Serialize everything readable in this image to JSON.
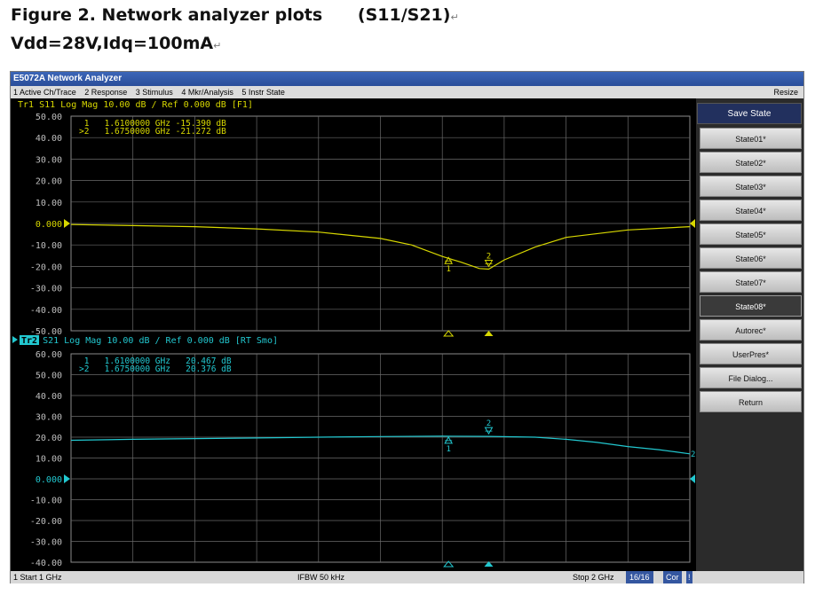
{
  "caption": {
    "line1": "Figure 2. Network analyzer plots      (S11/S21)",
    "line2": "Vdd=28V,Idq=100mA"
  },
  "window": {
    "title": "E5072A Network Analyzer"
  },
  "menu": {
    "items": [
      "1 Active Ch/Trace",
      "2 Response",
      "3 Stimulus",
      "4 Mkr/Analysis",
      "5 Instr State"
    ],
    "resize": "Resize"
  },
  "trace1": {
    "header_id": "Tr1",
    "header_rest": " S11  Log Mag 10.00 dB / Ref 0.000 dB [F1]",
    "y_ticks": [
      "50.00",
      "40.00",
      "30.00",
      "20.00",
      "10.00",
      "0.000",
      "-10.00",
      "-20.00",
      "-30.00",
      "-40.00",
      "-50.00"
    ],
    "markers": [
      {
        "line": " 1   1.6100000 GHz -15.390 dB"
      },
      {
        "line": ">2   1.6750000 GHz -21.272 dB"
      }
    ],
    "color": "#d8d800"
  },
  "trace2": {
    "header_id": "Tr2",
    "header_rest": " S21  Log Mag 10.00 dB / Ref 0.000 dB [RT Smo]",
    "y_ticks": [
      "60.00",
      "50.00",
      "40.00",
      "30.00",
      "20.00",
      "10.00",
      "0.000",
      "-10.00",
      "-20.00",
      "-30.00",
      "-40.00"
    ],
    "markers": [
      {
        "line": " 1   1.6100000 GHz   20.467 dB"
      },
      {
        "line": ">2   1.6750000 GHz   20.376 dB"
      }
    ],
    "color": "#22c8d0"
  },
  "chart_data": [
    {
      "type": "line",
      "title": "Tr1 S11 Log Mag 10.00 dB / Ref 0.000 dB [F1]",
      "xlabel": "",
      "ylabel": "",
      "xlim": [
        1.0,
        2.0
      ],
      "ylim": [
        -50,
        50
      ],
      "grid": true,
      "series": [
        {
          "name": "S11",
          "x": [
            1.0,
            1.1,
            1.2,
            1.3,
            1.4,
            1.5,
            1.55,
            1.6,
            1.63,
            1.66,
            1.675,
            1.7,
            1.75,
            1.8,
            1.9,
            2.0
          ],
          "values": [
            -0.5,
            -1,
            -1.5,
            -2.5,
            -4,
            -7,
            -10,
            -15.39,
            -18,
            -21,
            -21.272,
            -17,
            -11,
            -6.5,
            -3,
            -1.5
          ]
        }
      ],
      "markers": [
        {
          "x": 1.61,
          "y": -15.39,
          "label": "1"
        },
        {
          "x": 1.675,
          "y": -21.272,
          "label": "2"
        }
      ]
    },
    {
      "type": "line",
      "title": "Tr2 S21 Log Mag 10.00 dB / Ref 0.000 dB [RT Smo]",
      "xlabel": "",
      "ylabel": "",
      "xlim": [
        1.0,
        2.0
      ],
      "ylim": [
        -40,
        60
      ],
      "grid": true,
      "series": [
        {
          "name": "S21",
          "x": [
            1.0,
            1.1,
            1.2,
            1.3,
            1.4,
            1.5,
            1.6,
            1.675,
            1.75,
            1.8,
            1.85,
            1.9,
            1.95,
            2.0
          ],
          "values": [
            18.5,
            19,
            19.3,
            19.6,
            20,
            20.3,
            20.467,
            20.376,
            20,
            19,
            17.5,
            15.5,
            14,
            12
          ]
        }
      ],
      "markers": [
        {
          "x": 1.61,
          "y": 20.467,
          "label": "1"
        },
        {
          "x": 1.675,
          "y": 20.376,
          "label": "2"
        }
      ]
    }
  ],
  "softkeys": {
    "title": "Save State",
    "items": [
      "State01*",
      "State02*",
      "State03*",
      "State04*",
      "State05*",
      "State06*",
      "State07*",
      "State08*",
      "Autorec*",
      "UserPres*",
      "File Dialog...",
      "Return"
    ],
    "active_index": 7
  },
  "status": {
    "start": "1  Start 1 GHz",
    "ifbw": "IFBW 50 kHz",
    "stop": "Stop 2 GHz",
    "count": "16/16",
    "cor": "Cor",
    "excl": "!"
  }
}
